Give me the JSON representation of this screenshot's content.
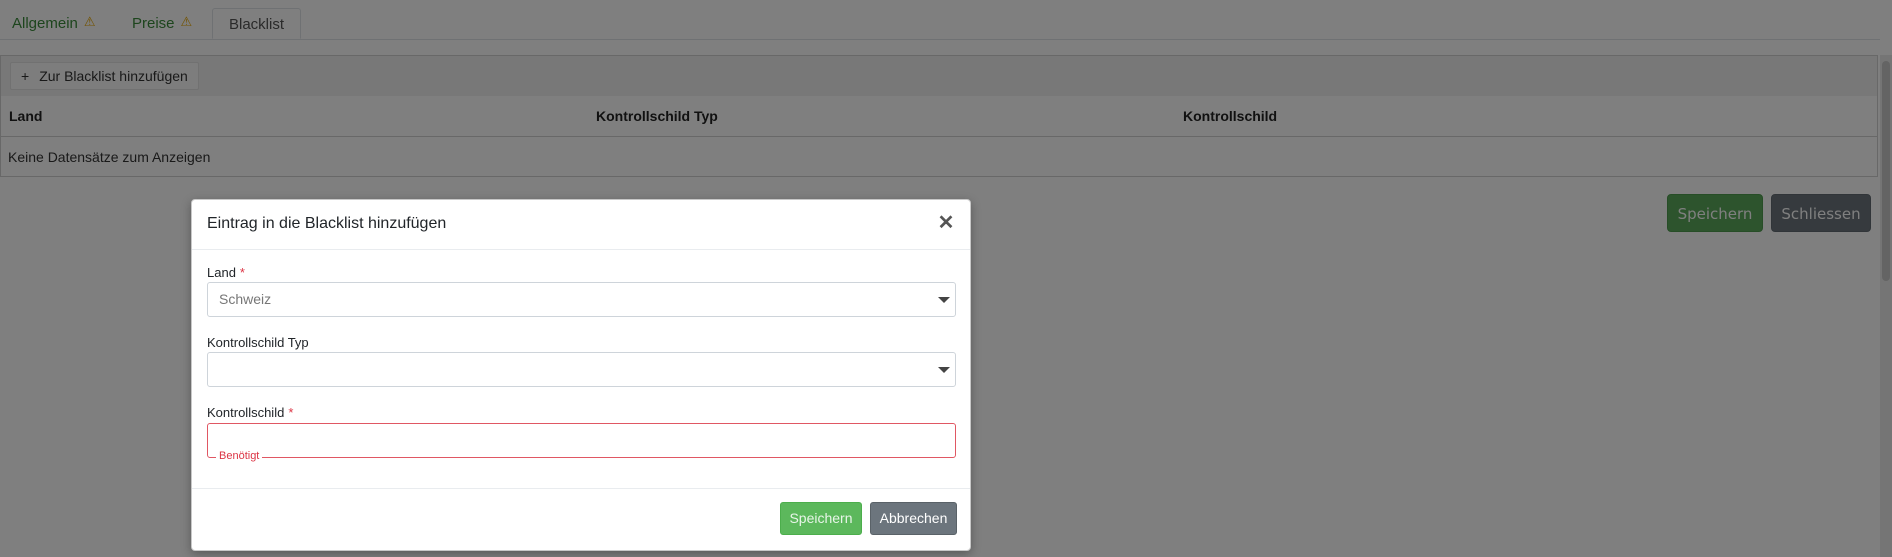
{
  "tabs": [
    {
      "label": "Allgemein",
      "warning": "⚠"
    },
    {
      "label": "Preise",
      "warning": "⚠"
    },
    {
      "label": "Blacklist"
    }
  ],
  "toolbar": {
    "add_icon": "+",
    "add_label": "Zur Blacklist hinzufügen"
  },
  "table": {
    "columns": [
      "Land",
      "Kontrollschild Typ",
      "Kontrollschild"
    ],
    "empty_message": "Keine Datensätze zum Anzeigen"
  },
  "page_actions": {
    "save_label": "Speichern",
    "close_label": "Schliessen"
  },
  "modal": {
    "title": "Eintrag in die Blacklist hinzufügen",
    "close_glyph": "✕",
    "fields": {
      "land": {
        "label": "Land",
        "required_mark": "*",
        "value": "Schweiz"
      },
      "plate_type": {
        "label": "Kontrollschild Typ",
        "value": ""
      },
      "plate": {
        "label": "Kontrollschild",
        "required_mark": "*",
        "value": "",
        "error": "Benötigt"
      }
    },
    "buttons": {
      "save_label": "Speichern",
      "cancel_label": "Abbrechen"
    }
  },
  "colors": {
    "accent_green": "#5cb85c",
    "secondary_gray": "#6c757d",
    "error_red": "#dc3545",
    "tab_green": "#3a8a3a",
    "warning_amber": "#e6a700"
  }
}
